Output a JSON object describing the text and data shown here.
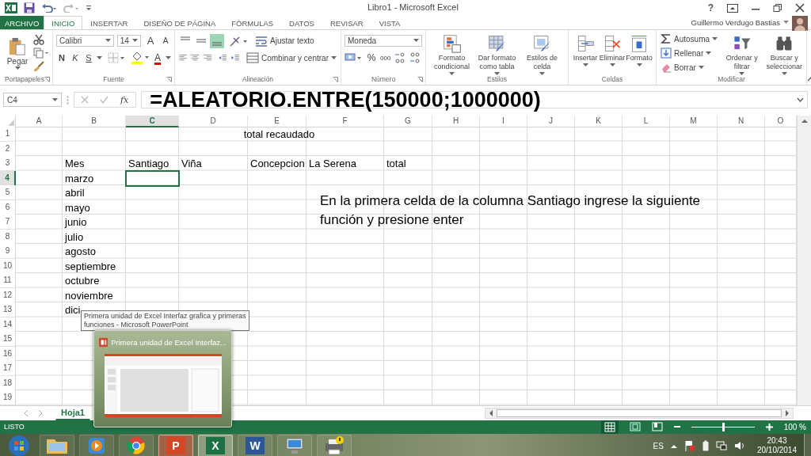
{
  "window": {
    "title": "Libro1 - Microsoft Excel",
    "help": "?"
  },
  "user": {
    "name": "Guillermo Verdugo Bastias"
  },
  "tabs": [
    {
      "label": "ARCHIVO",
      "kind": "file",
      "selected": false
    },
    {
      "label": "INICIO",
      "kind": "tab",
      "selected": true
    },
    {
      "label": "INSERTAR",
      "kind": "tab",
      "selected": false
    },
    {
      "label": "DISEÑO DE PÁGINA",
      "kind": "tab",
      "selected": false
    },
    {
      "label": "FÓRMULAS",
      "kind": "tab",
      "selected": false
    },
    {
      "label": "DATOS",
      "kind": "tab",
      "selected": false
    },
    {
      "label": "REVISAR",
      "kind": "tab",
      "selected": false
    },
    {
      "label": "VISTA",
      "kind": "tab",
      "selected": false
    }
  ],
  "ribbon": {
    "clipboard": {
      "label": "Portapapeles",
      "paste": "Pegar"
    },
    "font": {
      "label": "Fuente",
      "family": "Calibri",
      "size": "14",
      "grow": "A",
      "shrink": "A",
      "bold": "N",
      "italic": "K",
      "underline": "S",
      "font_letter": "A"
    },
    "alignment": {
      "label": "Alineación",
      "vertical": [
        {
          "selected": false
        },
        {
          "selected": false
        },
        {
          "selected": true
        }
      ],
      "wrap": "Ajustar texto",
      "merge": "Combinar y centrar"
    },
    "number": {
      "label": "Número",
      "format": "Moneda",
      "percent": "%",
      "thousands": "000"
    },
    "styles": {
      "label": "Estilos",
      "buttons": [
        "Formato condicional",
        "Dar formato como tabla",
        "Estilos de celda"
      ]
    },
    "cells": {
      "label": "Celdas",
      "buttons": [
        "Insertar",
        "Eliminar",
        "Formato"
      ]
    },
    "editing": {
      "label": "Modificar",
      "small": [
        "Autosuma",
        "Rellenar",
        "Borrar"
      ],
      "buttons": [
        "Ordenar y filtrar",
        "Buscar y seleccionar"
      ]
    }
  },
  "formula_bar": {
    "name_box": "C4",
    "fx": "fx",
    "formula": "=ALEATORIO.ENTRE(150000;1000000)"
  },
  "sheet": {
    "title": "total recaudado",
    "note": "En la primera celda de la columna Santiago ingrese la siguiente función y presione enter",
    "columns": [
      {
        "label": "A",
        "selected": false
      },
      {
        "label": "B",
        "selected": false
      },
      {
        "label": "C",
        "selected": true
      },
      {
        "label": "D",
        "selected": false
      },
      {
        "label": "E",
        "selected": false
      },
      {
        "label": "F",
        "selected": false
      },
      {
        "label": "G",
        "selected": false
      },
      {
        "label": "H",
        "selected": false
      },
      {
        "label": "I",
        "selected": false
      },
      {
        "label": "J",
        "selected": false
      },
      {
        "label": "K",
        "selected": false
      },
      {
        "label": "L",
        "selected": false
      },
      {
        "label": "M",
        "selected": false
      },
      {
        "label": "N",
        "selected": false
      },
      {
        "label": "O",
        "selected": false
      }
    ],
    "rows": [
      {
        "label": "1",
        "selected": false
      },
      {
        "label": "2",
        "selected": false
      },
      {
        "label": "3",
        "selected": false,
        "cells": [
          null,
          "Mes",
          "Santiago",
          "Viña",
          "Concepcion",
          "La Serena",
          "total"
        ]
      },
      {
        "label": "4",
        "selected": true,
        "cells": [
          null,
          "marzo"
        ]
      },
      {
        "label": "5",
        "selected": false,
        "cells": [
          null,
          "abril"
        ]
      },
      {
        "label": "6",
        "selected": false,
        "cells": [
          null,
          "mayo"
        ]
      },
      {
        "label": "7",
        "selected": false,
        "cells": [
          null,
          "junio"
        ]
      },
      {
        "label": "8",
        "selected": false,
        "cells": [
          null,
          "julio"
        ]
      },
      {
        "label": "9",
        "selected": false,
        "cells": [
          null,
          "agosto"
        ]
      },
      {
        "label": "10",
        "selected": false,
        "cells": [
          null,
          "septiembre"
        ]
      },
      {
        "label": "11",
        "selected": false,
        "cells": [
          null,
          "octubre"
        ]
      },
      {
        "label": "12",
        "selected": false,
        "cells": [
          null,
          "noviembre"
        ]
      },
      {
        "label": "13",
        "selected": false,
        "cells": [
          null,
          "dici"
        ]
      },
      {
        "label": "14",
        "selected": false
      },
      {
        "label": "15",
        "selected": false
      },
      {
        "label": "16",
        "selected": false
      },
      {
        "label": "17",
        "selected": false
      },
      {
        "label": "18",
        "selected": false
      },
      {
        "label": "19",
        "selected": false
      }
    ]
  },
  "sheet_tabs": [
    {
      "label": "Hoja1",
      "selected": true
    }
  ],
  "status_bar": {
    "text": "LISTO",
    "zoom": "100 %",
    "zoom_slider": {
      "level": 0.5
    }
  },
  "tooltip": "Primera unidad de Excel Interfaz grafica y primeras funciones - Microsoft PowerPoint",
  "preview": {
    "title": "Primera unidad de Excel Interfaz..."
  },
  "taskbar": {
    "apps": [
      {
        "kind": "start",
        "selected": false
      },
      {
        "kind": "folder",
        "selected": false
      },
      {
        "kind": "media",
        "selected": false
      },
      {
        "kind": "browser",
        "selected": false
      },
      {
        "kind": "slides",
        "glyph": "P",
        "selected": true
      },
      {
        "kind": "sheets",
        "glyph": "X",
        "selected": true
      },
      {
        "kind": "document",
        "glyph": "W",
        "selected": false
      },
      {
        "kind": "network",
        "selected": false
      },
      {
        "kind": "printer",
        "selected": false
      }
    ],
    "language": "ES",
    "time": "20:43",
    "date": "20/10/2014"
  }
}
